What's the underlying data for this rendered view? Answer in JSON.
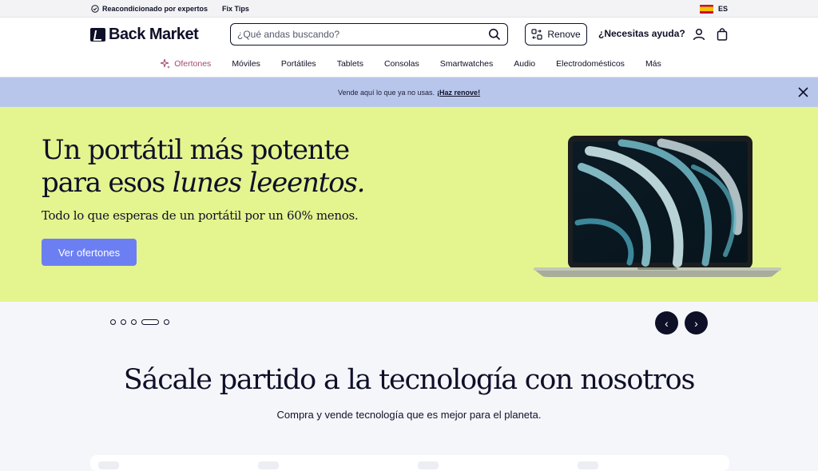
{
  "topbar": {
    "refurbished_label": "Reacondicionado por expertos",
    "fix_tips_label": "Fix Tips",
    "language": "ES"
  },
  "header": {
    "logo_text": "Back Market",
    "search_placeholder": "¿Qué andas buscando?",
    "renove_label": "Renove",
    "help_label": "¿Necesitas ayuda?"
  },
  "nav": {
    "items": [
      "Ofertones",
      "Móviles",
      "Portátiles",
      "Tablets",
      "Consolas",
      "Smartwatches",
      "Audio",
      "Electrodomésticos",
      "Más"
    ]
  },
  "promo": {
    "text": "Vende aquí lo que ya no usas.",
    "link": "¡Haz renove!"
  },
  "hero": {
    "title_line1": "Un portátil más potente",
    "title_line2_plain": "para esos ",
    "title_line2_italic": "lunes leeentos.",
    "subtitle": "Todo lo que esperas de un portátil por un 60% menos.",
    "cta_label": "Ver ofertones",
    "accent_color": "#e4f48f",
    "button_color": "#6c7ff2"
  },
  "carousel": {
    "slides": 5,
    "active_slide": 4,
    "prev_symbol": "‹",
    "next_symbol": "›"
  },
  "section": {
    "title": "Sácale partido a la tecnología con nosotros",
    "subtitle": "Compra y vende tecnología que es mejor para el planeta."
  }
}
